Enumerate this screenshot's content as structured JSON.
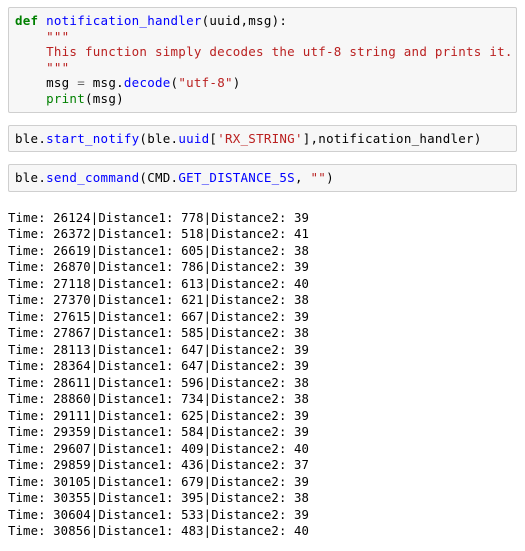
{
  "cells": [
    {
      "id": "cell-notification-handler",
      "type": "code",
      "lines": [
        [
          {
            "t": "def",
            "c": "kw"
          },
          {
            "t": " ",
            "c": "plain"
          },
          {
            "t": "notification_handler",
            "c": "fname"
          },
          {
            "t": "(uuid,msg):",
            "c": "plain"
          }
        ],
        [
          {
            "t": "    \"\"\"",
            "c": "doc"
          }
        ],
        [
          {
            "t": "    This function simply decodes the utf-8 string and prints it.",
            "c": "doc"
          }
        ],
        [
          {
            "t": "    \"\"\"",
            "c": "doc"
          }
        ],
        [
          {
            "t": "    msg ",
            "c": "plain"
          },
          {
            "t": "=",
            "c": "eq"
          },
          {
            "t": " msg.",
            "c": "plain"
          },
          {
            "t": "decode",
            "c": "attr"
          },
          {
            "t": "(",
            "c": "plain"
          },
          {
            "t": "\"utf-8\"",
            "c": "str"
          },
          {
            "t": ")",
            "c": "plain"
          }
        ],
        [
          {
            "t": "    ",
            "c": "plain"
          },
          {
            "t": "print",
            "c": "builtin"
          },
          {
            "t": "(msg)",
            "c": "plain"
          }
        ]
      ]
    },
    {
      "id": "cell-start-notify",
      "type": "code",
      "lines": [
        [
          {
            "t": "ble.",
            "c": "plain"
          },
          {
            "t": "start_notify",
            "c": "attr"
          },
          {
            "t": "(ble.",
            "c": "plain"
          },
          {
            "t": "uuid",
            "c": "attr"
          },
          {
            "t": "[",
            "c": "plain"
          },
          {
            "t": "'RX_STRING'",
            "c": "str"
          },
          {
            "t": "],notification_handler)",
            "c": "plain"
          }
        ]
      ]
    },
    {
      "id": "cell-send-command",
      "type": "code",
      "lines": [
        [
          {
            "t": "ble.",
            "c": "plain"
          },
          {
            "t": "send_command",
            "c": "attr"
          },
          {
            "t": "(CMD.",
            "c": "plain"
          },
          {
            "t": "GET_DISTANCE_5S",
            "c": "attr"
          },
          {
            "t": ", ",
            "c": "plain"
          },
          {
            "t": "\"\"",
            "c": "str"
          },
          {
            "t": ")",
            "c": "plain"
          }
        ]
      ]
    }
  ],
  "output": {
    "id": "stream-output",
    "lines": [
      "Time: 26124|Distance1: 778|Distance2: 39",
      "Time: 26372|Distance1: 518|Distance2: 41",
      "Time: 26619|Distance1: 605|Distance2: 38",
      "Time: 26870|Distance1: 786|Distance2: 39",
      "Time: 27118|Distance1: 613|Distance2: 40",
      "Time: 27370|Distance1: 621|Distance2: 38",
      "Time: 27615|Distance1: 667|Distance2: 39",
      "Time: 27867|Distance1: 585|Distance2: 38",
      "Time: 28113|Distance1: 647|Distance2: 39",
      "Time: 28364|Distance1: 647|Distance2: 39",
      "Time: 28611|Distance1: 596|Distance2: 38",
      "Time: 28860|Distance1: 734|Distance2: 38",
      "Time: 29111|Distance1: 625|Distance2: 39",
      "Time: 29359|Distance1: 584|Distance2: 39",
      "Time: 29607|Distance1: 409|Distance2: 40",
      "Time: 29859|Distance1: 436|Distance2: 37",
      "Time: 30105|Distance1: 679|Distance2: 39",
      "Time: 30355|Distance1: 395|Distance2: 38",
      "Time: 30604|Distance1: 533|Distance2: 39",
      "Time: 30856|Distance1: 483|Distance2: 40"
    ],
    "records": [
      {
        "time": 26124,
        "distance1": 778,
        "distance2": 39
      },
      {
        "time": 26372,
        "distance1": 518,
        "distance2": 41
      },
      {
        "time": 26619,
        "distance1": 605,
        "distance2": 38
      },
      {
        "time": 26870,
        "distance1": 786,
        "distance2": 39
      },
      {
        "time": 27118,
        "distance1": 613,
        "distance2": 40
      },
      {
        "time": 27370,
        "distance1": 621,
        "distance2": 38
      },
      {
        "time": 27615,
        "distance1": 667,
        "distance2": 39
      },
      {
        "time": 27867,
        "distance1": 585,
        "distance2": 38
      },
      {
        "time": 28113,
        "distance1": 647,
        "distance2": 39
      },
      {
        "time": 28364,
        "distance1": 647,
        "distance2": 39
      },
      {
        "time": 28611,
        "distance1": 596,
        "distance2": 38
      },
      {
        "time": 28860,
        "distance1": 734,
        "distance2": 38
      },
      {
        "time": 29111,
        "distance1": 625,
        "distance2": 39
      },
      {
        "time": 29359,
        "distance1": 584,
        "distance2": 39
      },
      {
        "time": 29607,
        "distance1": 409,
        "distance2": 40
      },
      {
        "time": 29859,
        "distance1": 436,
        "distance2": 37
      },
      {
        "time": 30105,
        "distance1": 679,
        "distance2": 39
      },
      {
        "time": 30355,
        "distance1": 395,
        "distance2": 38
      },
      {
        "time": 30604,
        "distance1": 533,
        "distance2": 39
      },
      {
        "time": 30856,
        "distance1": 483,
        "distance2": 40
      }
    ]
  },
  "colors": {
    "cell_background": "#f7f7f7",
    "cell_border": "#cfcfcf",
    "page_background": "#ffffff",
    "keyword": "#008000",
    "function_name": "#0000ff",
    "string": "#ba2121",
    "builtin": "#008000",
    "operator": "#666666",
    "text": "#000000"
  }
}
